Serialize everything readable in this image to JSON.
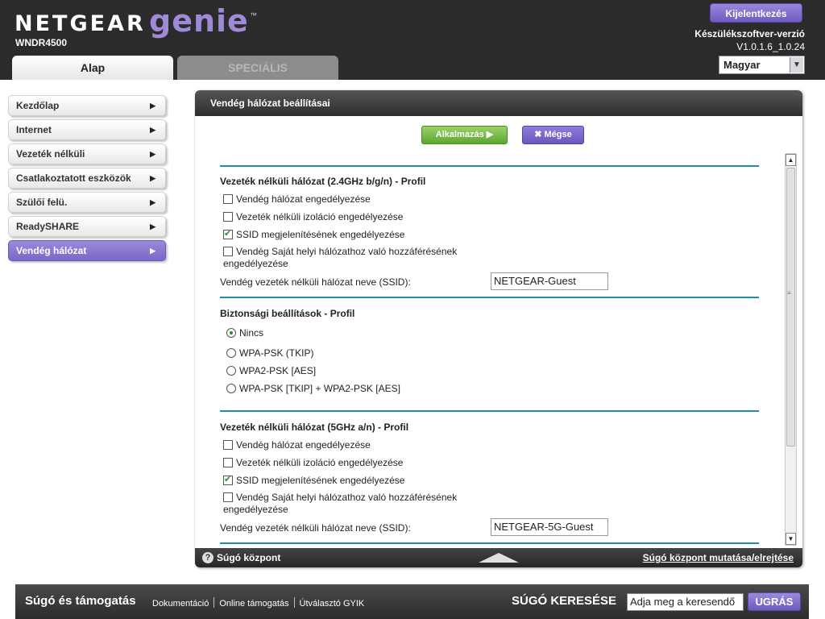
{
  "header": {
    "brand_netgear": "NETGEAR",
    "brand_genie": "genie",
    "trademark": "™",
    "model": "WNDR4500",
    "logout_label": "Kijelentkezés",
    "firmware_label": "Készülékszoftver-verzió",
    "firmware_version": "V1.0.1.6_1.0.24",
    "language": "Magyar"
  },
  "tabs": [
    {
      "label": "Alap",
      "active": true
    },
    {
      "label": "SPECIÁLIS",
      "active": false
    }
  ],
  "sidebar": {
    "items": [
      {
        "label": "Kezdőlap"
      },
      {
        "label": "Internet"
      },
      {
        "label": "Vezeték nélküli"
      },
      {
        "label": "Csatlakoztatott eszközök"
      },
      {
        "label": "Szülői felü."
      },
      {
        "label": "ReadySHARE"
      },
      {
        "label": "Vendég hálózat",
        "active": true
      }
    ]
  },
  "panel": {
    "title": "Vendég hálózat beállításai",
    "apply_label": "Alkalmazás",
    "cancel_label": "Mégse",
    "section_24": {
      "title": "Vezeték nélküli hálózat (2.4GHz b/g/n) - Profil",
      "options": [
        {
          "label": "Vendég hálózat engedélyezése",
          "checked": false
        },
        {
          "label": "Vezeték nélküli izoláció engedélyezése",
          "checked": false
        },
        {
          "label": "SSID megjelenítésének engedélyezése",
          "checked": true
        },
        {
          "label": "Vendég Saját helyi hálózathoz való hozzáférésének engedélyezése",
          "checked": false
        }
      ],
      "ssid_label": "Vendég vezeték nélküli hálózat neve (SSID):",
      "ssid_value": "NETGEAR-Guest"
    },
    "security": {
      "title": "Biztonsági beállítások - Profil",
      "options": [
        {
          "label": "Nincs",
          "selected": true
        },
        {
          "label": "WPA-PSK (TKIP)",
          "selected": false
        },
        {
          "label": "WPA2-PSK [AES]",
          "selected": false
        },
        {
          "label": "WPA-PSK [TKIP] + WPA2-PSK [AES]",
          "selected": false
        }
      ]
    },
    "section_5": {
      "title": "Vezeték nélküli hálózat (5GHz a/n) - Profil",
      "options": [
        {
          "label": "Vendég hálózat engedélyezése",
          "checked": false
        },
        {
          "label": "Vezeték nélküli izoláció engedélyezése",
          "checked": false
        },
        {
          "label": "SSID megjelenítésének engedélyezése",
          "checked": true
        },
        {
          "label": "Vendég Saját helyi hálózathoz való hozzáférésének engedélyezése",
          "checked": false
        }
      ],
      "ssid_label": "Vendég vezeték nélküli hálózat neve (SSID):",
      "ssid_value": "NETGEAR-5G-Guest"
    },
    "help_center_label": "Súgó központ",
    "help_toggle_label": "Súgó központ mutatása/elrejtése"
  },
  "footer": {
    "title": "Súgó és támogatás",
    "links": [
      "Dokumentáció",
      "Online támogatás",
      "Útválasztó GYIK"
    ],
    "search_label": "SÚGÓ KERESÉSE",
    "search_placeholder": "Adja meg a keresendő",
    "go_label": "UGRÁS"
  },
  "colors": {
    "accent_purple": "#7c66c8",
    "accent_green": "#5ea62f",
    "divider_teal": "#1f8fa8",
    "header_bg": "#2b2b2b"
  },
  "icons": [
    "chevron-right-icon",
    "close-icon",
    "help-icon",
    "chevron-down-icon",
    "scroll-up-icon",
    "scroll-down-icon"
  ]
}
